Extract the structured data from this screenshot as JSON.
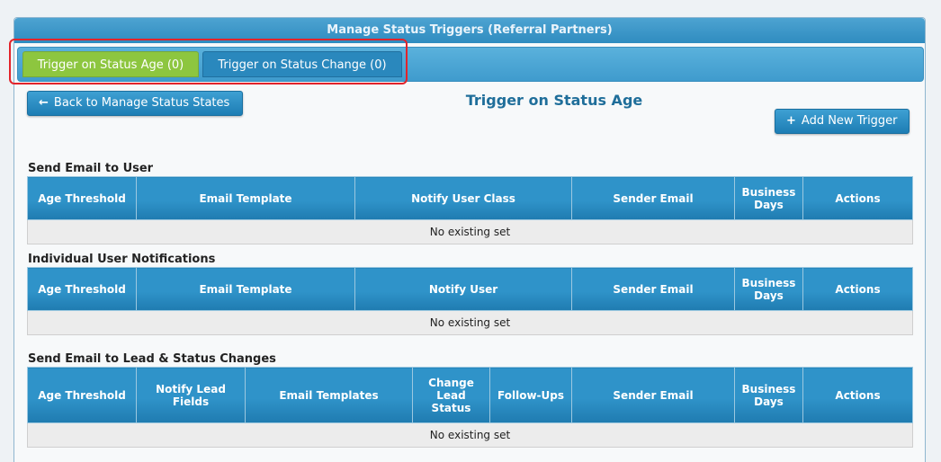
{
  "header": {
    "title": "Manage Status Triggers (Referral Partners)"
  },
  "tabs": [
    {
      "label": "Trigger on Status Age (0)"
    },
    {
      "label": "Trigger on Status Change (0)"
    }
  ],
  "toolbar": {
    "back_label": "Back to Manage Status States",
    "back_icon": "←",
    "add_label": "Add New Trigger",
    "add_icon": "+"
  },
  "page_title": "Trigger on Status Age",
  "sections": [
    {
      "title": "Send Email to User",
      "columns": [
        "Age Threshold",
        "Email Template",
        "Notify User Class",
        "Sender Email",
        "Business Days",
        "Actions"
      ],
      "empty_text": "No existing set"
    },
    {
      "title": "Individual User Notifications",
      "columns": [
        "Age Threshold",
        "Email Template",
        "Notify User",
        "Sender Email",
        "Business Days",
        "Actions"
      ],
      "empty_text": "No existing set"
    },
    {
      "title": "Send Email to Lead & Status Changes",
      "columns": [
        "Age Threshold",
        "Notify Lead Fields",
        "Email Templates",
        "Change Lead Status",
        "Follow-Ups",
        "Sender Email",
        "Business Days",
        "Actions"
      ],
      "empty_text": "No existing set"
    }
  ],
  "colors": {
    "header_blue": "#2f8cc0",
    "active_tab_green": "#8dc63f",
    "highlight_red": "#e2232a",
    "title_blue": "#1f6e9a"
  }
}
